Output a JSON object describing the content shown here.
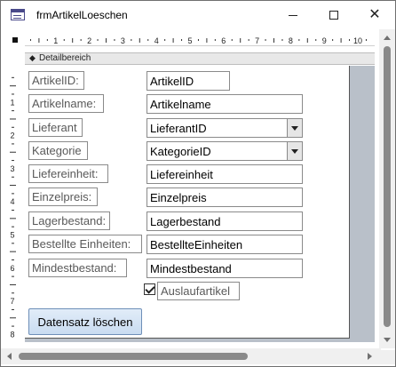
{
  "window": {
    "title": "frmArtikelLoeschen",
    "minimize": "minimize",
    "maximize": "maximize",
    "close": "close"
  },
  "ruler": {
    "h_numbers": [
      "1",
      "2",
      "3",
      "4",
      "5",
      "6",
      "7",
      "8",
      "9",
      "10"
    ],
    "v_numbers": [
      "1",
      "2",
      "3",
      "4",
      "5",
      "6",
      "7",
      "8"
    ]
  },
  "section": {
    "label": "Detailbereich"
  },
  "fields": [
    {
      "label": "ArtikelID:",
      "control": "ArtikelID",
      "kind": "text"
    },
    {
      "label": "Artikelname:",
      "control": "Artikelname",
      "kind": "text"
    },
    {
      "label": "Lieferant",
      "control": "LieferantID",
      "kind": "combo"
    },
    {
      "label": "Kategorie",
      "control": "KategorieID",
      "kind": "combo"
    },
    {
      "label": "Liefereinheit:",
      "control": "Liefereinheit",
      "kind": "text"
    },
    {
      "label": "Einzelpreis:",
      "control": "Einzelpreis",
      "kind": "text"
    },
    {
      "label": "Lagerbestand:",
      "control": "Lagerbestand",
      "kind": "text"
    },
    {
      "label": "Bestellte Einheiten:",
      "control": "BestellteEinheiten",
      "kind": "text"
    },
    {
      "label": "Mindestbestand:",
      "control": "Mindestbestand",
      "kind": "text"
    }
  ],
  "checkbox": {
    "label": "Auslaufartikel",
    "checked": true
  },
  "button": {
    "label": "Datensatz löschen"
  },
  "colors": {
    "form_grid": "#b9c0c9",
    "button_fill": "#c9dcf1",
    "button_border": "#6e8fb8",
    "label_text": "#595959"
  },
  "icons": {
    "app": "form-icon",
    "section": "section-arrow-icon",
    "combo": "chevron-down-icon"
  }
}
